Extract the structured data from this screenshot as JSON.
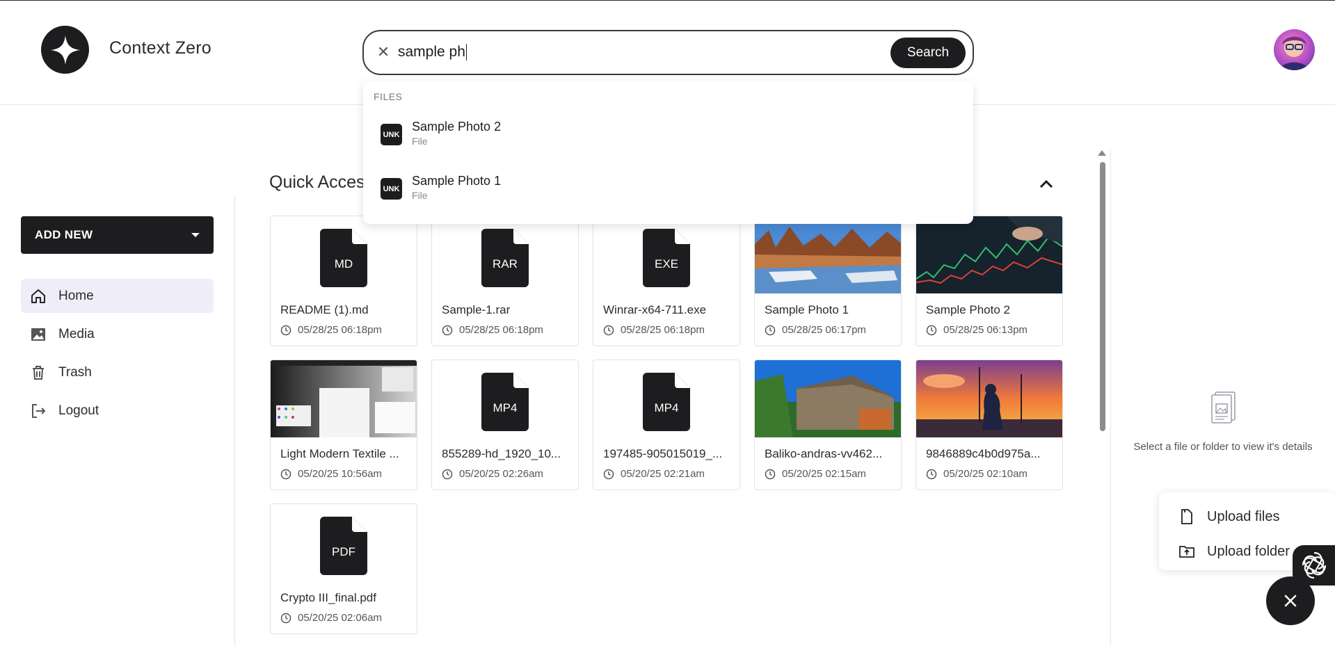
{
  "app": {
    "brand": "Context Zero"
  },
  "search": {
    "value": "sample ph",
    "button_label": "Search"
  },
  "dropdown": {
    "heading": "FILES",
    "results": [
      {
        "badge": "UNK",
        "title": "Sample Photo 2",
        "subtitle": "File"
      },
      {
        "badge": "UNK",
        "title": "Sample Photo 1",
        "subtitle": "File"
      }
    ]
  },
  "sidebar": {
    "add_new_label": "ADD NEW",
    "items": [
      {
        "label": "Home",
        "icon": "home-icon",
        "active": true
      },
      {
        "label": "Media",
        "icon": "image-icon",
        "active": false
      },
      {
        "label": "Trash",
        "icon": "trash-icon",
        "active": false
      },
      {
        "label": "Logout",
        "icon": "logout-icon",
        "active": false
      }
    ]
  },
  "main": {
    "section_title": "Quick Acces",
    "files": [
      {
        "name": "README (1).md",
        "date": "05/28/25 06:18pm",
        "kind": "MD"
      },
      {
        "name": "Sample-1.rar",
        "date": "05/28/25 06:18pm",
        "kind": "RAR"
      },
      {
        "name": "Winrar-x64-711.exe",
        "date": "05/28/25 06:18pm",
        "kind": "EXE"
      },
      {
        "name": "Sample Photo 1",
        "date": "05/28/25 06:17pm",
        "kind": "image-river"
      },
      {
        "name": "Sample Photo 2",
        "date": "05/28/25 06:13pm",
        "kind": "image-chart"
      },
      {
        "name": "Light Modern Textile ...",
        "date": "05/20/25 10:56am",
        "kind": "image-screenshot"
      },
      {
        "name": "855289-hd_1920_10...",
        "date": "05/20/25 02:26am",
        "kind": "MP4"
      },
      {
        "name": "197485-905015019_...",
        "date": "05/20/25 02:21am",
        "kind": "MP4"
      },
      {
        "name": "Baliko-andras-vv462...",
        "date": "05/20/25 02:15am",
        "kind": "image-house"
      },
      {
        "name": "9846889c4b0d975a...",
        "date": "05/20/25 02:10am",
        "kind": "image-sunset"
      },
      {
        "name": "Crypto III_final.pdf",
        "date": "05/20/25 02:06am",
        "kind": "PDF"
      }
    ]
  },
  "details": {
    "empty_text": "Select a file or folder to view it's details"
  },
  "upload_menu": {
    "files_label": "Upload files",
    "folder_label": "Upload folder"
  }
}
